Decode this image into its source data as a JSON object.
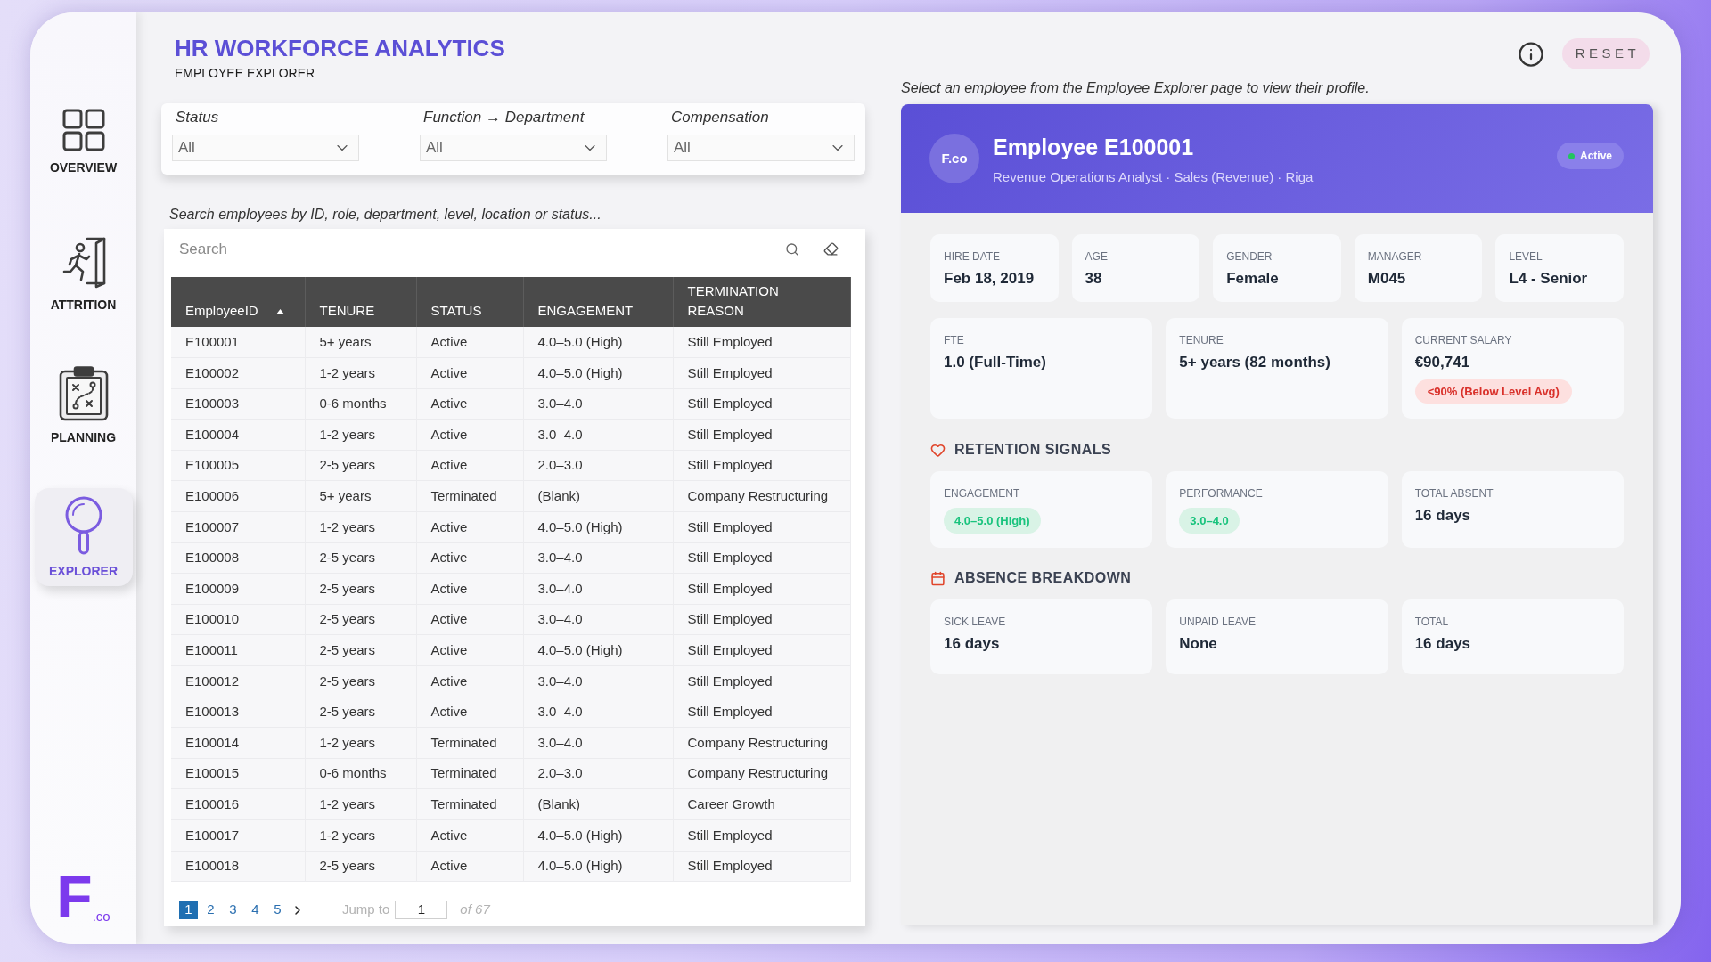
{
  "sidebar": {
    "items": [
      {
        "label": "OVERVIEW",
        "selected": false
      },
      {
        "label": "ATTRITION",
        "selected": false
      },
      {
        "label": "PLANNING",
        "selected": false
      },
      {
        "label": "EXPLORER",
        "selected": true
      }
    ],
    "logo": {
      "mark": "F",
      "suffix": ".co"
    }
  },
  "header": {
    "title": "HR WORKFORCE ANALYTICS",
    "subtitle": "EMPLOYEE EXPLORER"
  },
  "filters": [
    {
      "label": "Status",
      "value": "All"
    },
    {
      "label": "Function → Department",
      "value": "All"
    },
    {
      "label": "Compensation",
      "value": "All"
    }
  ],
  "search": {
    "hint": "Search employees by ID, role, department, level, location or status...",
    "placeholder": "Search"
  },
  "table": {
    "columns": [
      {
        "label": "EmployeeID",
        "sorted": true
      },
      {
        "label": "TENURE",
        "sorted": false
      },
      {
        "label": "STATUS",
        "sorted": false
      },
      {
        "label": "ENGAGEMENT",
        "sorted": false
      },
      {
        "label": "TERMINATION REASON",
        "sorted": false
      }
    ],
    "rows": [
      [
        "E100001",
        "5+ years",
        "Active",
        "4.0–5.0 (High)",
        "Still Employed"
      ],
      [
        "E100002",
        "1-2 years",
        "Active",
        "4.0–5.0 (High)",
        "Still Employed"
      ],
      [
        "E100003",
        "0-6 months",
        "Active",
        "3.0–4.0",
        "Still Employed"
      ],
      [
        "E100004",
        "1-2 years",
        "Active",
        "3.0–4.0",
        "Still Employed"
      ],
      [
        "E100005",
        "2-5 years",
        "Active",
        "2.0–3.0",
        "Still Employed"
      ],
      [
        "E100006",
        "5+ years",
        "Terminated",
        "(Blank)",
        "Company Restructuring"
      ],
      [
        "E100007",
        "1-2 years",
        "Active",
        "4.0–5.0 (High)",
        "Still Employed"
      ],
      [
        "E100008",
        "2-5 years",
        "Active",
        "3.0–4.0",
        "Still Employed"
      ],
      [
        "E100009",
        "2-5 years",
        "Active",
        "3.0–4.0",
        "Still Employed"
      ],
      [
        "E100010",
        "2-5 years",
        "Active",
        "3.0–4.0",
        "Still Employed"
      ],
      [
        "E100011",
        "2-5 years",
        "Active",
        "4.0–5.0 (High)",
        "Still Employed"
      ],
      [
        "E100012",
        "2-5 years",
        "Active",
        "3.0–4.0",
        "Still Employed"
      ],
      [
        "E100013",
        "2-5 years",
        "Active",
        "3.0–4.0",
        "Still Employed"
      ],
      [
        "E100014",
        "1-2 years",
        "Terminated",
        "3.0–4.0",
        "Company Restructuring"
      ],
      [
        "E100015",
        "0-6 months",
        "Terminated",
        "2.0–3.0",
        "Company Restructuring"
      ],
      [
        "E100016",
        "1-2 years",
        "Terminated",
        "(Blank)",
        "Career Growth"
      ],
      [
        "E100017",
        "1-2 years",
        "Active",
        "4.0–5.0 (High)",
        "Still Employed"
      ],
      [
        "E100018",
        "2-5 years",
        "Active",
        "4.0–5.0 (High)",
        "Still Employed"
      ]
    ]
  },
  "pagination": {
    "pages": [
      {
        "label": "1",
        "selected": true
      },
      {
        "label": "2",
        "selected": false
      },
      {
        "label": "3",
        "selected": false
      },
      {
        "label": "4",
        "selected": false
      },
      {
        "label": "5",
        "selected": false
      }
    ],
    "jump_label": "Jump to",
    "jump_value": "1",
    "total": "of 67"
  },
  "toolbar": {
    "reset": "RESET"
  },
  "profile": {
    "hint": "Select an employee from the Employee Explorer page to view their profile.",
    "avatar": "F.co",
    "name": "Employee E100001",
    "subtitle": "Revenue Operations Analyst · Sales (Revenue) · Riga",
    "status": "Active",
    "details": [
      {
        "label": "HIRE DATE",
        "value": "Feb 18, 2019"
      },
      {
        "label": "AGE",
        "value": "38"
      },
      {
        "label": "GENDER",
        "value": "Female"
      },
      {
        "label": "MANAGER",
        "value": "M045"
      },
      {
        "label": "LEVEL",
        "value": "L4 - Senior"
      }
    ],
    "details_2": [
      {
        "label": "FTE",
        "value": "1.0 (Full-Time)"
      },
      {
        "label": "TENURE",
        "value": "5+ years (82 months)"
      },
      {
        "label": "CURRENT SALARY",
        "value": "€90,741",
        "badge": {
          "text": "<90% (Below Level Avg)",
          "alert": true
        }
      }
    ],
    "retention_signals": {
      "title": "RETENTION SIGNALS",
      "items": [
        {
          "label": "ENGAGEMENT",
          "value": "4.0–5.0 (High)",
          "kind": "pill",
          "alert": false
        },
        {
          "label": "PERFORMANCE",
          "value": "3.0–4.0",
          "kind": "pill",
          "alert": false
        },
        {
          "label": "TOTAL ABSENT",
          "value": "16 days",
          "kind": "text"
        }
      ]
    },
    "absence_breakdown": {
      "title": "ABSENCE BREAKDOWN",
      "items": [
        {
          "label": "SICK LEAVE",
          "value": "16 days"
        },
        {
          "label": "UNPAID LEAVE",
          "value": "None"
        },
        {
          "label": "TOTAL",
          "value": "16 days"
        }
      ]
    }
  }
}
